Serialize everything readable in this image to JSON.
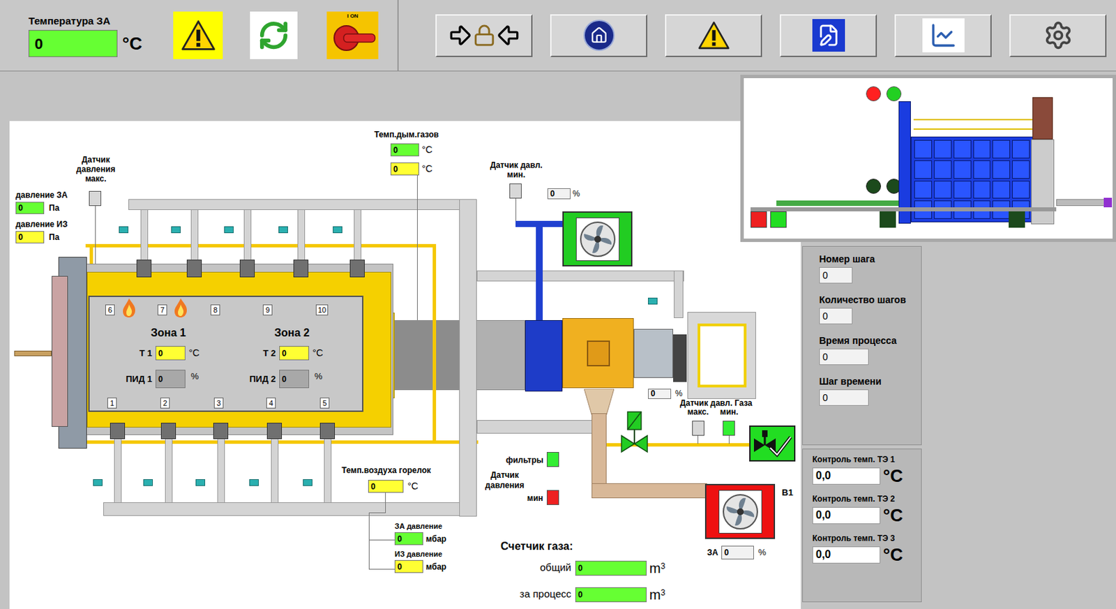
{
  "header": {
    "temperature_label": "Температура ЗА",
    "temperature_value": "0",
    "temperature_unit": "°C",
    "temperature_color": "#66ff33",
    "switch_label": "I ON"
  },
  "diagram": {
    "pressure_max_sensor": {
      "label": "Датчик давления макс.",
      "color": "#d8d8d8"
    },
    "pressure_za": {
      "label": "давление ЗА",
      "value": "0",
      "unit": "Па",
      "color": "#66ff33"
    },
    "pressure_iz": {
      "label": "давление ИЗ",
      "value": "0",
      "unit": "Па",
      "color": "#ffff33"
    },
    "flue_gas_temp": {
      "label": "Темп.дым.газов",
      "readings": [
        {
          "value": "0",
          "unit": "°C",
          "color": "#66ff33"
        },
        {
          "value": "0",
          "unit": "°C",
          "color": "#ffff33"
        }
      ]
    },
    "fan_pressure_sensor": {
      "label": "Датчик давл. мин.",
      "color": "#d8d8d8",
      "value": "0",
      "unit": "%"
    },
    "burners": [
      {
        "number": "1",
        "flame": false
      },
      {
        "number": "2",
        "flame": false
      },
      {
        "number": "3",
        "flame": false
      },
      {
        "number": "4",
        "flame": false
      },
      {
        "number": "5",
        "flame": false
      },
      {
        "number": "6",
        "flame": true
      },
      {
        "number": "7",
        "flame": true
      },
      {
        "number": "8",
        "flame": false
      },
      {
        "number": "9",
        "flame": false
      },
      {
        "number": "10",
        "flame": false
      }
    ],
    "zones": [
      {
        "name": "Зона 1",
        "t_label": "Т 1",
        "t_value": "0",
        "t_unit": "°C",
        "t_color": "#ffff33",
        "pid_label": "ПИД 1",
        "pid_value": "0",
        "pid_unit": "%",
        "pid_color": "#a8a8a8"
      },
      {
        "name": "Зона 2",
        "t_label": "Т 2",
        "t_value": "0",
        "t_unit": "°C",
        "t_color": "#ffff33",
        "pid_label": "ПИД 2",
        "pid_value": "0",
        "pid_unit": "%",
        "pid_color": "#a8a8a8"
      }
    ],
    "air_fan": {
      "color": "#22cc22"
    },
    "recuperator": {
      "value": "0",
      "unit": "%"
    },
    "gas_pressure": {
      "label": "Датчик давл. Газа",
      "sensors": [
        {
          "label": "макс.",
          "color": "#d8d8d8"
        },
        {
          "label": "мин.",
          "color": "#33ee33"
        }
      ]
    },
    "gas_valve": {
      "color": "#22cc22"
    },
    "gas_ok": {
      "color": "#22dd22",
      "ok": true
    },
    "filters": {
      "label": "фильтры",
      "color": "#33ee33"
    },
    "filter_pressure": {
      "label": "Датчик давления",
      "min_label": "мин",
      "color": "#ee2222"
    },
    "burner_air_temp": {
      "label": "Темп.воздуха горелок",
      "value": "0",
      "unit": "°C",
      "color": "#ffff33"
    },
    "gas_pressures": [
      {
        "label": "ЗА давление",
        "value": "0",
        "unit": "мбар",
        "color": "#66ff33"
      },
      {
        "label": "ИЗ давление",
        "value": "0",
        "unit": "мбар",
        "color": "#ffff33"
      }
    ],
    "exhaust_fan": {
      "name": "B1",
      "color": "#ee1111",
      "label": "ЗА",
      "value": "0",
      "unit": "%"
    },
    "gas_counter": {
      "title": "Счетчик газа:",
      "rows": [
        {
          "label": "общий",
          "value": "0",
          "unit": "m",
          "unit_sup": "3"
        },
        {
          "label": "за процесс",
          "value": "0",
          "unit": "m",
          "unit_sup": "3"
        }
      ]
    }
  },
  "minimap": {
    "lights": [
      {
        "color": "#ff2020"
      },
      {
        "color": "#22d022"
      },
      {
        "color": "#1c4a1c"
      },
      {
        "color": "#1c4a1c"
      }
    ],
    "markers": [
      {
        "color": "#ee2020"
      },
      {
        "color": "#22dd22"
      }
    ]
  },
  "steps": [
    {
      "label": "Номер шага",
      "value": "0"
    },
    {
      "label": "Количество шагов",
      "value": "0"
    },
    {
      "label": "Время процесса",
      "value": "0"
    },
    {
      "label": "Шаг времени",
      "value": "0"
    }
  ],
  "heater_control": [
    {
      "label": "Контроль темп. ТЭ 1",
      "value": "0,0",
      "unit": "°C"
    },
    {
      "label": "Контроль темп. ТЭ 2",
      "value": "0,0",
      "unit": "°C"
    },
    {
      "label": "Контроль темп. ТЭ 3",
      "value": "0,0",
      "unit": "°C"
    }
  ]
}
